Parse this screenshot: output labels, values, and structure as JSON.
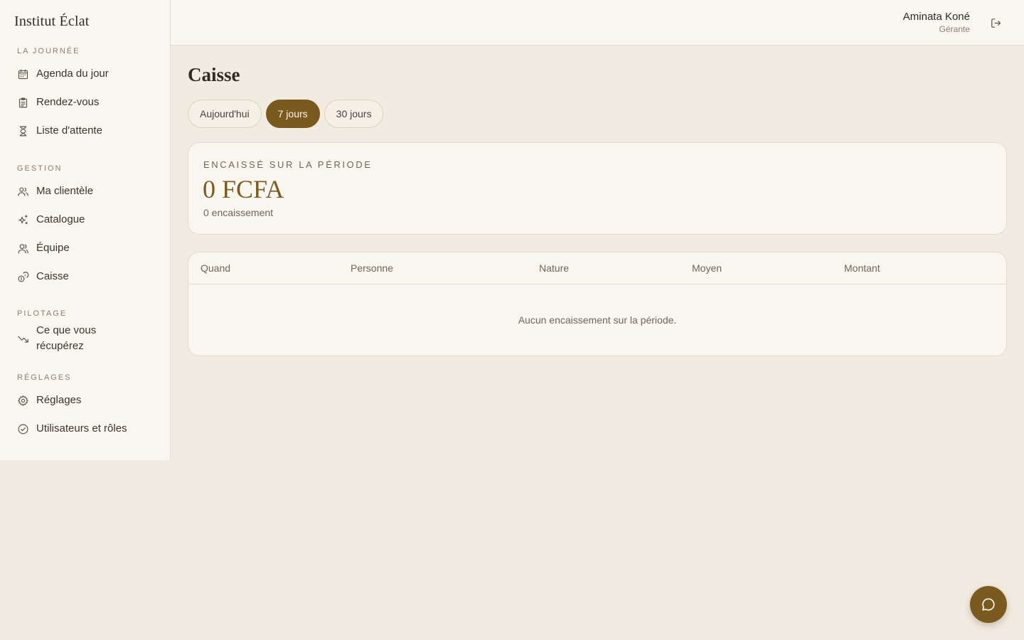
{
  "brand": {
    "name": "Institut Éclat"
  },
  "sidebar": {
    "sections": [
      {
        "label": "LA JOURNÉE",
        "items": [
          {
            "label": "Agenda du jour",
            "icon": "calendar-icon"
          },
          {
            "label": "Rendez-vous",
            "icon": "clipboard-icon"
          },
          {
            "label": "Liste d'attente",
            "icon": "hourglass-icon"
          }
        ]
      },
      {
        "label": "GESTION",
        "items": [
          {
            "label": "Ma clientèle",
            "icon": "users-icon"
          },
          {
            "label": "Catalogue",
            "icon": "sparkles-icon"
          },
          {
            "label": "Équipe",
            "icon": "team-icon"
          },
          {
            "label": "Caisse",
            "icon": "coins-icon"
          }
        ]
      },
      {
        "label": "PILOTAGE",
        "items": [
          {
            "label": "Ce que vous récupérez",
            "icon": "trending-down-icon"
          }
        ]
      },
      {
        "label": "RÉGLAGES",
        "items": [
          {
            "label": "Réglages",
            "icon": "gear-icon"
          },
          {
            "label": "Utilisateurs et rôles",
            "icon": "check-circle-icon"
          }
        ]
      }
    ]
  },
  "header": {
    "user_name": "Aminata Koné",
    "user_role": "Gérante",
    "logout_icon": "logout-icon"
  },
  "main": {
    "title": "Caisse",
    "tabs": [
      {
        "label": "Aujourd'hui",
        "active": false
      },
      {
        "label": "7 jours",
        "active": true
      },
      {
        "label": "30 jours",
        "active": false
      }
    ],
    "summary": {
      "label": "ENCAISSÉ SUR LA PÉRIODE",
      "amount": "0 FCFA",
      "count": "0 encaissement"
    },
    "table": {
      "columns": [
        "Quand",
        "Personne",
        "Nature",
        "Moyen",
        "Montant"
      ],
      "rows": [],
      "empty_message": "Aucun encaissement sur la période."
    }
  },
  "fab": {
    "icon": "chat-icon"
  },
  "colors": {
    "accent": "#7a5a1f",
    "background": "#f2ebe1",
    "surface": "#f9f6f0",
    "border": "#e4dbcd"
  }
}
